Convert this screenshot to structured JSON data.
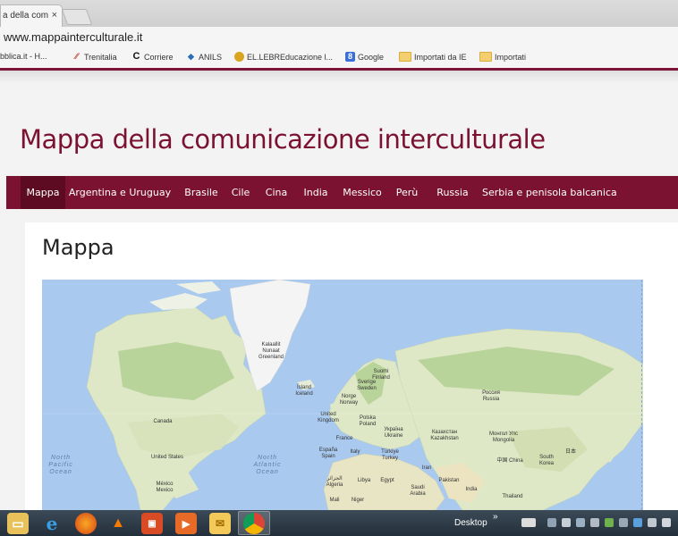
{
  "browser": {
    "tab_title": "a della com",
    "tab_close": "×",
    "url": "www.mappainterculturale.it",
    "bookmarks": [
      {
        "label": "bblica.it - H...",
        "icon": ""
      },
      {
        "label": "Trenitalia",
        "icon": "trenitalia-icon"
      },
      {
        "label": "Corriere",
        "icon": "corriere-icon"
      },
      {
        "label": "ANILS",
        "icon": "anils-icon"
      },
      {
        "label": "EL.LEBREducazione l...",
        "icon": "ellebre-icon"
      },
      {
        "label": "Google",
        "icon": "google-icon"
      },
      {
        "label": "Importati da IE",
        "icon": "folder-icon"
      },
      {
        "label": "Importati",
        "icon": "folder-icon"
      }
    ]
  },
  "site": {
    "title": "Mappa della comunicazione interculturale",
    "nav": [
      {
        "label": "Mappa",
        "active": true
      },
      {
        "label": "Argentina e Uruguay",
        "active": false
      },
      {
        "label": "Brasile",
        "active": false
      },
      {
        "label": "Cile",
        "active": false
      },
      {
        "label": "Cina",
        "active": false
      },
      {
        "label": "India",
        "active": false
      },
      {
        "label": "Messico",
        "active": false
      },
      {
        "label": "Perù",
        "active": false
      },
      {
        "label": "Russia",
        "active": false
      },
      {
        "label": "Serbia e penisola balcanica",
        "active": false
      }
    ],
    "heading": "Mappa"
  },
  "map": {
    "labels": {
      "greenland": "Kalaallit Nunaat Greenland",
      "iceland": "Ísland Iceland",
      "norway": "Norge Norway",
      "sweden": "Sverige Sweden",
      "finland": "Suomi Finland",
      "uk": "United Kingdom",
      "poland": "Polska Poland",
      "ukraine": "Україна Ukraine",
      "france": "France",
      "spain": "España Spain",
      "italy": "Italy",
      "turkey": "Türkiye Turkey",
      "russia": "Россия Russia",
      "kazakhstan": "Казахстан Kazakhstan",
      "mongolia": "Монгол Улс Mongolia",
      "china": "中国 China",
      "japan": "日本",
      "korea": "South Korea",
      "canada": "Canada",
      "usa": "United States",
      "mexico": "México Mexico",
      "algeria": "الجزائر Algeria",
      "libya": "Libya",
      "egypt": "Egypt",
      "saudi": "Saudi Arabia",
      "iran": "Iran",
      "pakistan": "Pakistan",
      "india": "India",
      "thailand": "Thailand",
      "mali": "Mali",
      "niger": "Niger",
      "north_pacific": "North Pacific Ocean",
      "north_atlantic": "North Atlantic Ocean"
    },
    "colors": {
      "water": "#a9c9ef",
      "land": "#dfe8c6",
      "forest": "#b9d49a",
      "ice": "#f4f4f4"
    }
  },
  "taskbar": {
    "desktop_label": "Desktop",
    "chevron": "»"
  },
  "colors": {
    "brand": "#7b1232",
    "brand_dark": "#5c0b23"
  }
}
